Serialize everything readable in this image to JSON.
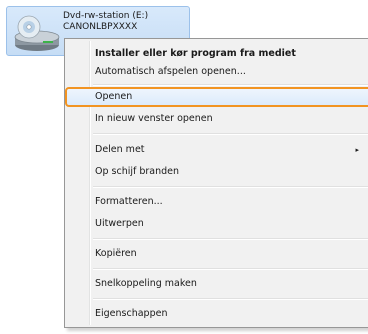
{
  "drive": {
    "name": "Dvd-rw-station (E:)",
    "label": "CANONLBPXXXX"
  },
  "menu": {
    "items": [
      {
        "label": "Installer eller kør program fra mediet",
        "bold": true
      },
      {
        "label": "Automatisch afspelen openen..."
      },
      {
        "label": "Openen",
        "highlighted": true
      },
      {
        "label": "In nieuw venster openen"
      },
      {
        "label": "Delen met",
        "submenu": true
      },
      {
        "label": "Op schijf branden"
      },
      {
        "label": "Formatteren..."
      },
      {
        "label": "Uitwerpen"
      },
      {
        "label": "Kopiëren"
      },
      {
        "label": "Snelkoppeling maken"
      },
      {
        "label": "Eigenschappen"
      }
    ],
    "submenu_arrow": "▸",
    "highlight_color": "#f29422"
  }
}
